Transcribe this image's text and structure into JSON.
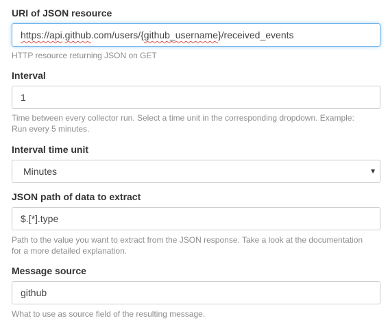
{
  "fields": {
    "uri": {
      "label": "URI of JSON resource",
      "value_parts": [
        "https://",
        "api",
        ".",
        "github",
        ".com/users/{",
        "github_username",
        "}/received_events"
      ],
      "help": "HTTP resource returning JSON on GET"
    },
    "interval": {
      "label": "Interval",
      "value": "1",
      "help_line1": "Time between every collector run. Select a time unit in the corresponding dropdown. Example:",
      "help_line2": "Run every 5 minutes."
    },
    "interval_unit": {
      "label": "Interval time unit",
      "selected": "Minutes"
    },
    "json_path": {
      "label": "JSON path of data to extract",
      "value": "$.[*].type",
      "help_line1": "Path to the value you want to extract from the JSON response. Take a look at the documentation",
      "help_line2": "for a more detailed explanation."
    },
    "message_source": {
      "label": "Message source",
      "value": "github",
      "help": "What to use as source field of the resulting message."
    }
  },
  "colors": {
    "focus_border": "#66afe9",
    "input_border": "#cccccc",
    "help_text": "#8c8c8c",
    "spellcheck_underline": "#d9534f"
  },
  "icons": {
    "dropdown": "caret-down-icon"
  }
}
